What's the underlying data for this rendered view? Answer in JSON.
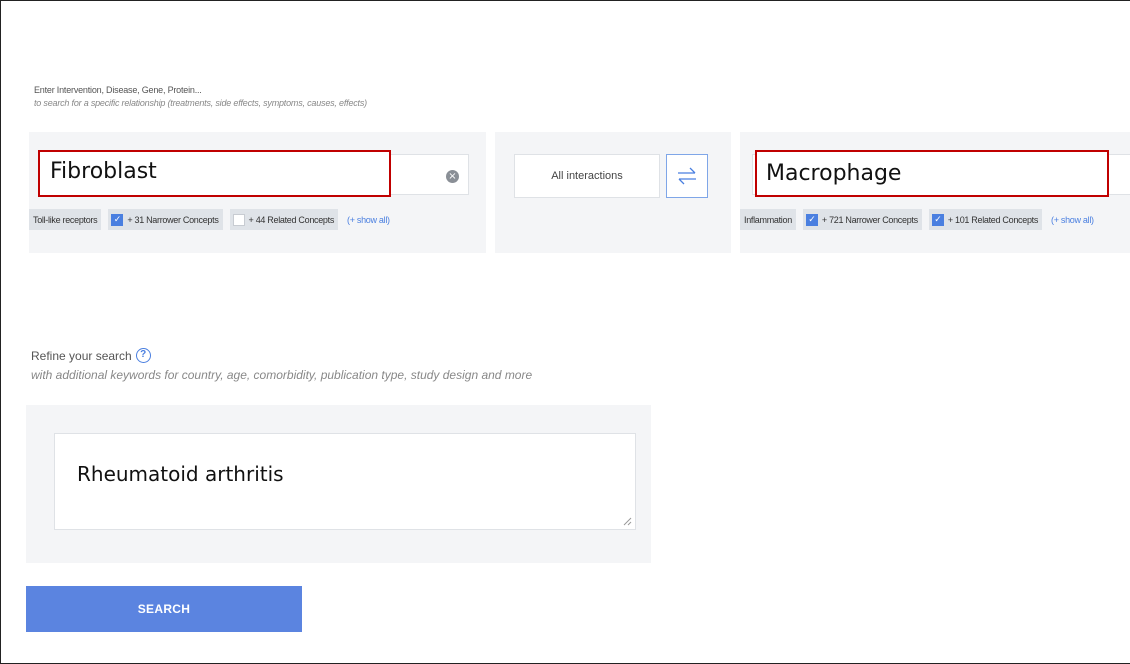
{
  "hint": {
    "title": "Enter Intervention, Disease, Gene, Protein...",
    "subtitle": "to search for a specific relationship (treatments, side effects, symptoms, causes, effects)"
  },
  "left_term": {
    "value": "Fibroblast",
    "chips": {
      "concept": "Toll-like receptors",
      "narrower_label": "+ 31 Narrower Concepts",
      "narrower_checked": true,
      "related_label": "+ 44 Related Concepts",
      "related_checked": false,
      "show_all": "(+ show all)"
    }
  },
  "middle": {
    "interaction_select": "All interactions"
  },
  "right_term": {
    "value": "Macrophage",
    "chips": {
      "concept": "Inflammation",
      "narrower_label": "+ 721 Narrower Concepts",
      "narrower_checked": true,
      "related_label": "+ 101 Related Concepts",
      "related_checked": true,
      "show_all": "(+ show all)"
    }
  },
  "refine": {
    "title": "Refine your search",
    "help_glyph": "?",
    "subtitle": "with additional keywords for country, age, comorbidity, publication type, study design and more",
    "value": "Rheumatoid arthritis"
  },
  "search_button": {
    "label": "SEARCH"
  },
  "colors": {
    "accent": "#4a7fe0",
    "button": "#5b84e0",
    "highlight": "#c00000",
    "panel": "#f4f5f7"
  }
}
